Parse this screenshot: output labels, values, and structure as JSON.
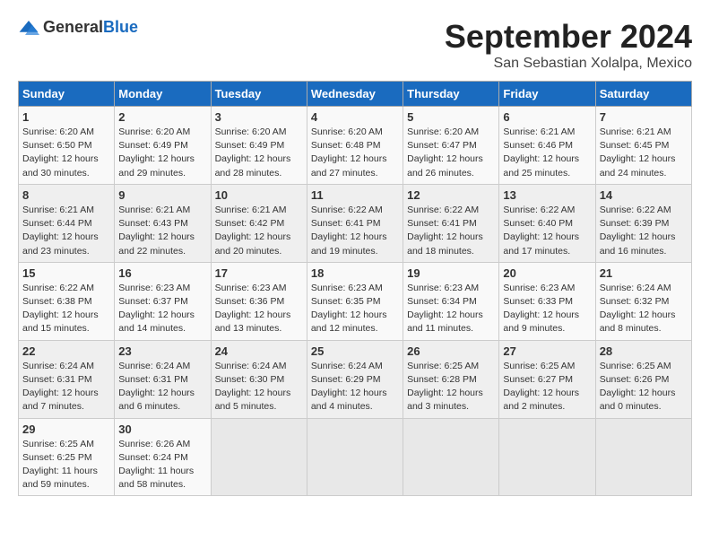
{
  "header": {
    "logo_general": "General",
    "logo_blue": "Blue",
    "month_title": "September 2024",
    "subtitle": "San Sebastian Xolalpa, Mexico"
  },
  "days_of_week": [
    "Sunday",
    "Monday",
    "Tuesday",
    "Wednesday",
    "Thursday",
    "Friday",
    "Saturday"
  ],
  "weeks": [
    [
      {
        "day": "1",
        "detail": "Sunrise: 6:20 AM\nSunset: 6:50 PM\nDaylight: 12 hours\nand 30 minutes."
      },
      {
        "day": "2",
        "detail": "Sunrise: 6:20 AM\nSunset: 6:49 PM\nDaylight: 12 hours\nand 29 minutes."
      },
      {
        "day": "3",
        "detail": "Sunrise: 6:20 AM\nSunset: 6:49 PM\nDaylight: 12 hours\nand 28 minutes."
      },
      {
        "day": "4",
        "detail": "Sunrise: 6:20 AM\nSunset: 6:48 PM\nDaylight: 12 hours\nand 27 minutes."
      },
      {
        "day": "5",
        "detail": "Sunrise: 6:20 AM\nSunset: 6:47 PM\nDaylight: 12 hours\nand 26 minutes."
      },
      {
        "day": "6",
        "detail": "Sunrise: 6:21 AM\nSunset: 6:46 PM\nDaylight: 12 hours\nand 25 minutes."
      },
      {
        "day": "7",
        "detail": "Sunrise: 6:21 AM\nSunset: 6:45 PM\nDaylight: 12 hours\nand 24 minutes."
      }
    ],
    [
      {
        "day": "8",
        "detail": "Sunrise: 6:21 AM\nSunset: 6:44 PM\nDaylight: 12 hours\nand 23 minutes."
      },
      {
        "day": "9",
        "detail": "Sunrise: 6:21 AM\nSunset: 6:43 PM\nDaylight: 12 hours\nand 22 minutes."
      },
      {
        "day": "10",
        "detail": "Sunrise: 6:21 AM\nSunset: 6:42 PM\nDaylight: 12 hours\nand 20 minutes."
      },
      {
        "day": "11",
        "detail": "Sunrise: 6:22 AM\nSunset: 6:41 PM\nDaylight: 12 hours\nand 19 minutes."
      },
      {
        "day": "12",
        "detail": "Sunrise: 6:22 AM\nSunset: 6:41 PM\nDaylight: 12 hours\nand 18 minutes."
      },
      {
        "day": "13",
        "detail": "Sunrise: 6:22 AM\nSunset: 6:40 PM\nDaylight: 12 hours\nand 17 minutes."
      },
      {
        "day": "14",
        "detail": "Sunrise: 6:22 AM\nSunset: 6:39 PM\nDaylight: 12 hours\nand 16 minutes."
      }
    ],
    [
      {
        "day": "15",
        "detail": "Sunrise: 6:22 AM\nSunset: 6:38 PM\nDaylight: 12 hours\nand 15 minutes."
      },
      {
        "day": "16",
        "detail": "Sunrise: 6:23 AM\nSunset: 6:37 PM\nDaylight: 12 hours\nand 14 minutes."
      },
      {
        "day": "17",
        "detail": "Sunrise: 6:23 AM\nSunset: 6:36 PM\nDaylight: 12 hours\nand 13 minutes."
      },
      {
        "day": "18",
        "detail": "Sunrise: 6:23 AM\nSunset: 6:35 PM\nDaylight: 12 hours\nand 12 minutes."
      },
      {
        "day": "19",
        "detail": "Sunrise: 6:23 AM\nSunset: 6:34 PM\nDaylight: 12 hours\nand 11 minutes."
      },
      {
        "day": "20",
        "detail": "Sunrise: 6:23 AM\nSunset: 6:33 PM\nDaylight: 12 hours\nand 9 minutes."
      },
      {
        "day": "21",
        "detail": "Sunrise: 6:24 AM\nSunset: 6:32 PM\nDaylight: 12 hours\nand 8 minutes."
      }
    ],
    [
      {
        "day": "22",
        "detail": "Sunrise: 6:24 AM\nSunset: 6:31 PM\nDaylight: 12 hours\nand 7 minutes."
      },
      {
        "day": "23",
        "detail": "Sunrise: 6:24 AM\nSunset: 6:31 PM\nDaylight: 12 hours\nand 6 minutes."
      },
      {
        "day": "24",
        "detail": "Sunrise: 6:24 AM\nSunset: 6:30 PM\nDaylight: 12 hours\nand 5 minutes."
      },
      {
        "day": "25",
        "detail": "Sunrise: 6:24 AM\nSunset: 6:29 PM\nDaylight: 12 hours\nand 4 minutes."
      },
      {
        "day": "26",
        "detail": "Sunrise: 6:25 AM\nSunset: 6:28 PM\nDaylight: 12 hours\nand 3 minutes."
      },
      {
        "day": "27",
        "detail": "Sunrise: 6:25 AM\nSunset: 6:27 PM\nDaylight: 12 hours\nand 2 minutes."
      },
      {
        "day": "28",
        "detail": "Sunrise: 6:25 AM\nSunset: 6:26 PM\nDaylight: 12 hours\nand 0 minutes."
      }
    ],
    [
      {
        "day": "29",
        "detail": "Sunrise: 6:25 AM\nSunset: 6:25 PM\nDaylight: 11 hours\nand 59 minutes."
      },
      {
        "day": "30",
        "detail": "Sunrise: 6:26 AM\nSunset: 6:24 PM\nDaylight: 11 hours\nand 58 minutes."
      },
      {
        "day": "",
        "detail": ""
      },
      {
        "day": "",
        "detail": ""
      },
      {
        "day": "",
        "detail": ""
      },
      {
        "day": "",
        "detail": ""
      },
      {
        "day": "",
        "detail": ""
      }
    ]
  ]
}
